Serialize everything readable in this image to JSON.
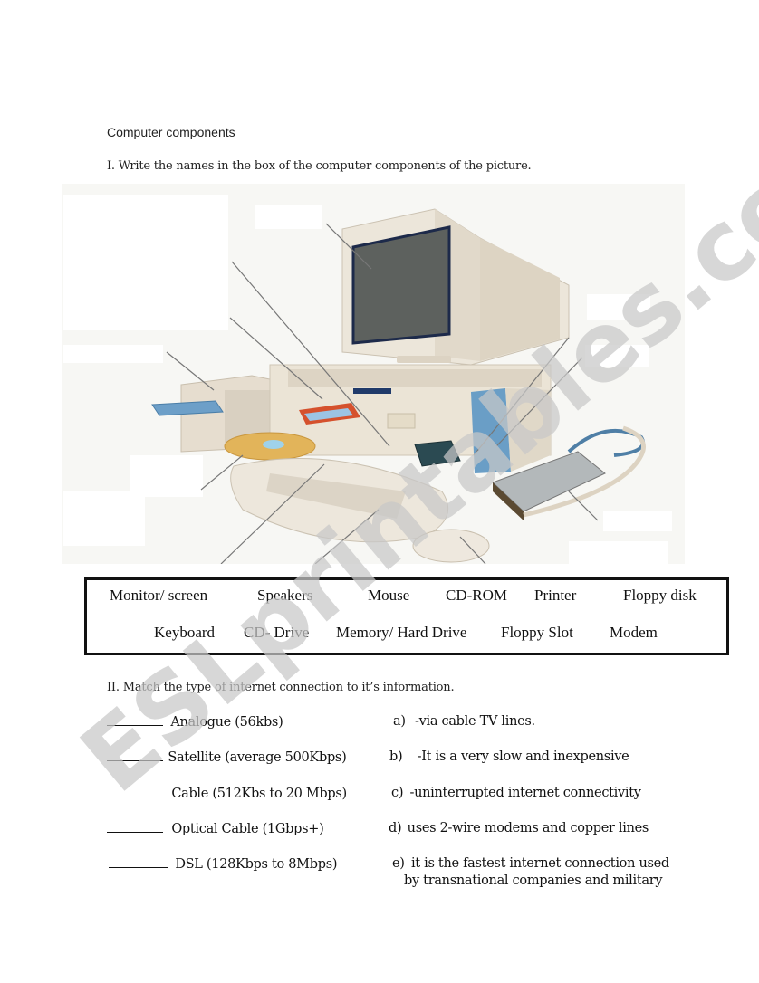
{
  "worksheet": {
    "title": "Computer components",
    "section1": {
      "instruction": "I. Write the names in the box of the computer components of the picture.",
      "picture_label": "computer illustration with blank label boxes",
      "word_bank": {
        "row1": [
          "Monitor/ screen",
          "Speakers",
          "Mouse",
          "CD-ROM",
          "Printer",
          "Floppy disk"
        ],
        "row2": [
          "Keyboard",
          "CD- Drive",
          "Memory/ Hard Drive",
          "Floppy Slot",
          "Modem"
        ]
      }
    },
    "section2": {
      "instruction": "II.   Match the type of internet connection to it’s information.",
      "connections": [
        {
          "blank": "________",
          "name": "Analogue (56kbs)"
        },
        {
          "blank": "________",
          "name": "Satellite (average 500Kbps)"
        },
        {
          "blank": "________",
          "name": "Cable (512Kbs to 20 Mbps)"
        },
        {
          "blank": "________",
          "name": "Optical Cable (1Gbps+)"
        },
        {
          "blank": "_________",
          "name": "DSL (128Kbps to 8Mbps)"
        }
      ],
      "descriptions": [
        {
          "label": "a)",
          "text": "-via cable TV lines."
        },
        {
          "label": "b)",
          "text": "-It is a very slow and inexpensive"
        },
        {
          "label": "c)",
          "text": "-uninterrupted internet connectivity"
        },
        {
          "label": "d)",
          "text": "uses 2-wire modems and copper lines"
        },
        {
          "label": "e)",
          "text": "it is the fastest internet connection used",
          "text2": "by transnational companies and military"
        }
      ]
    },
    "watermark": "ESLprintables.com",
    "colors": {
      "watermark": "#c8c8c8",
      "screen": "#5d615e",
      "beige": "#e9e1d3",
      "blue": "#6a9ec6"
    }
  }
}
